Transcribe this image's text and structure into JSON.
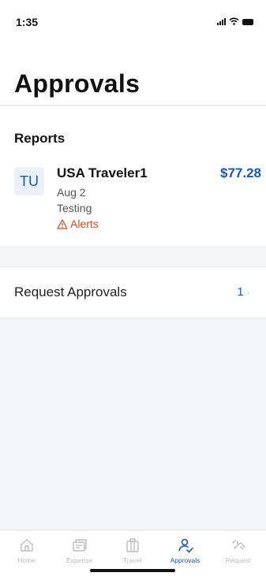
{
  "status_bar": {
    "time": "1:35"
  },
  "header": {
    "title": "Approvals"
  },
  "reports": {
    "section_title": "Reports",
    "items": [
      {
        "initials": "TU",
        "name": "USA Traveler1",
        "amount": "$77.28",
        "date": "Aug 2",
        "description": "Testing",
        "alerts_label": "Alerts"
      }
    ]
  },
  "request_approvals": {
    "label": "Request Approvals",
    "count": "1"
  },
  "tab_bar": {
    "active": "Approvals",
    "items": [
      {
        "label": "Home",
        "icon": "home-icon"
      },
      {
        "label": "Expense",
        "icon": "expense-icon"
      },
      {
        "label": "Travel",
        "icon": "travel-icon"
      },
      {
        "label": "Approvals",
        "icon": "approvals-icon"
      },
      {
        "label": "Request",
        "icon": "request-icon"
      }
    ]
  },
  "colors": {
    "accent": "#1458b8",
    "alert": "#d64b1a",
    "inactive_tab": "#b9bcc1",
    "background": "#f4f5f7"
  }
}
